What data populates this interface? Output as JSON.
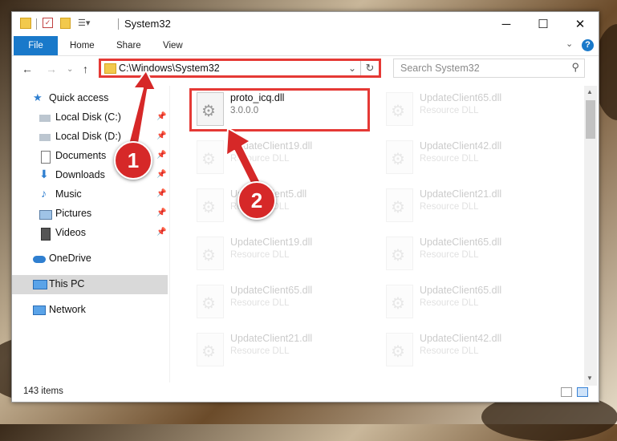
{
  "window": {
    "title": "System32"
  },
  "ribbon": {
    "tabs": [
      {
        "label": "File",
        "active": true
      },
      {
        "label": "Home"
      },
      {
        "label": "Share"
      },
      {
        "label": "View"
      }
    ]
  },
  "address": {
    "path": "C:\\Windows\\System32",
    "search_placeholder": "Search System32"
  },
  "sidebar": {
    "items": [
      {
        "label": "Quick access",
        "icon": "star-icon"
      },
      {
        "label": "Local Disk (C:)",
        "icon": "drive-icon",
        "pinned": true
      },
      {
        "label": "Local Disk (D:)",
        "icon": "drive-icon",
        "pinned": true
      },
      {
        "label": "Documents",
        "icon": "documents-icon",
        "pinned": true
      },
      {
        "label": "Downloads",
        "icon": "download-icon",
        "pinned": true
      },
      {
        "label": "Music",
        "icon": "music-icon",
        "pinned": true
      },
      {
        "label": "Pictures",
        "icon": "pictures-icon",
        "pinned": true
      },
      {
        "label": "Videos",
        "icon": "videos-icon",
        "pinned": true
      },
      {
        "label": "OneDrive",
        "icon": "cloud-icon"
      },
      {
        "label": "This PC",
        "icon": "computer-icon",
        "selected": true
      },
      {
        "label": "Network",
        "icon": "network-icon"
      }
    ]
  },
  "files": [
    {
      "name": "proto_icq.dll",
      "sub": "3.0.0.0",
      "highlighted": true
    },
    {
      "name": "UpdateClient65.dll",
      "sub": "Resource DLL"
    },
    {
      "name": "UpdateClient19.dll",
      "sub": "Resource DLL"
    },
    {
      "name": "UpdateClient42.dll",
      "sub": "Resource DLL"
    },
    {
      "name": "UpdateClient5.dll",
      "sub": "Resource DLL"
    },
    {
      "name": "UpdateClient21.dll",
      "sub": "Resource DLL"
    },
    {
      "name": "UpdateClient19.dll",
      "sub": "Resource DLL"
    },
    {
      "name": "UpdateClient65.dll",
      "sub": "Resource DLL"
    },
    {
      "name": "UpdateClient65.dll",
      "sub": "Resource DLL"
    },
    {
      "name": "UpdateClient65.dll",
      "sub": "Resource DLL"
    },
    {
      "name": "UpdateClient21.dll",
      "sub": "Resource DLL"
    },
    {
      "name": "UpdateClient42.dll",
      "sub": "Resource DLL"
    }
  ],
  "status": {
    "item_count": "143 items"
  },
  "annotations": {
    "step1": "1",
    "step2": "2"
  },
  "colors": {
    "accent": "#1979ca",
    "highlight_red": "#e53935",
    "badge_red": "#d62828"
  }
}
